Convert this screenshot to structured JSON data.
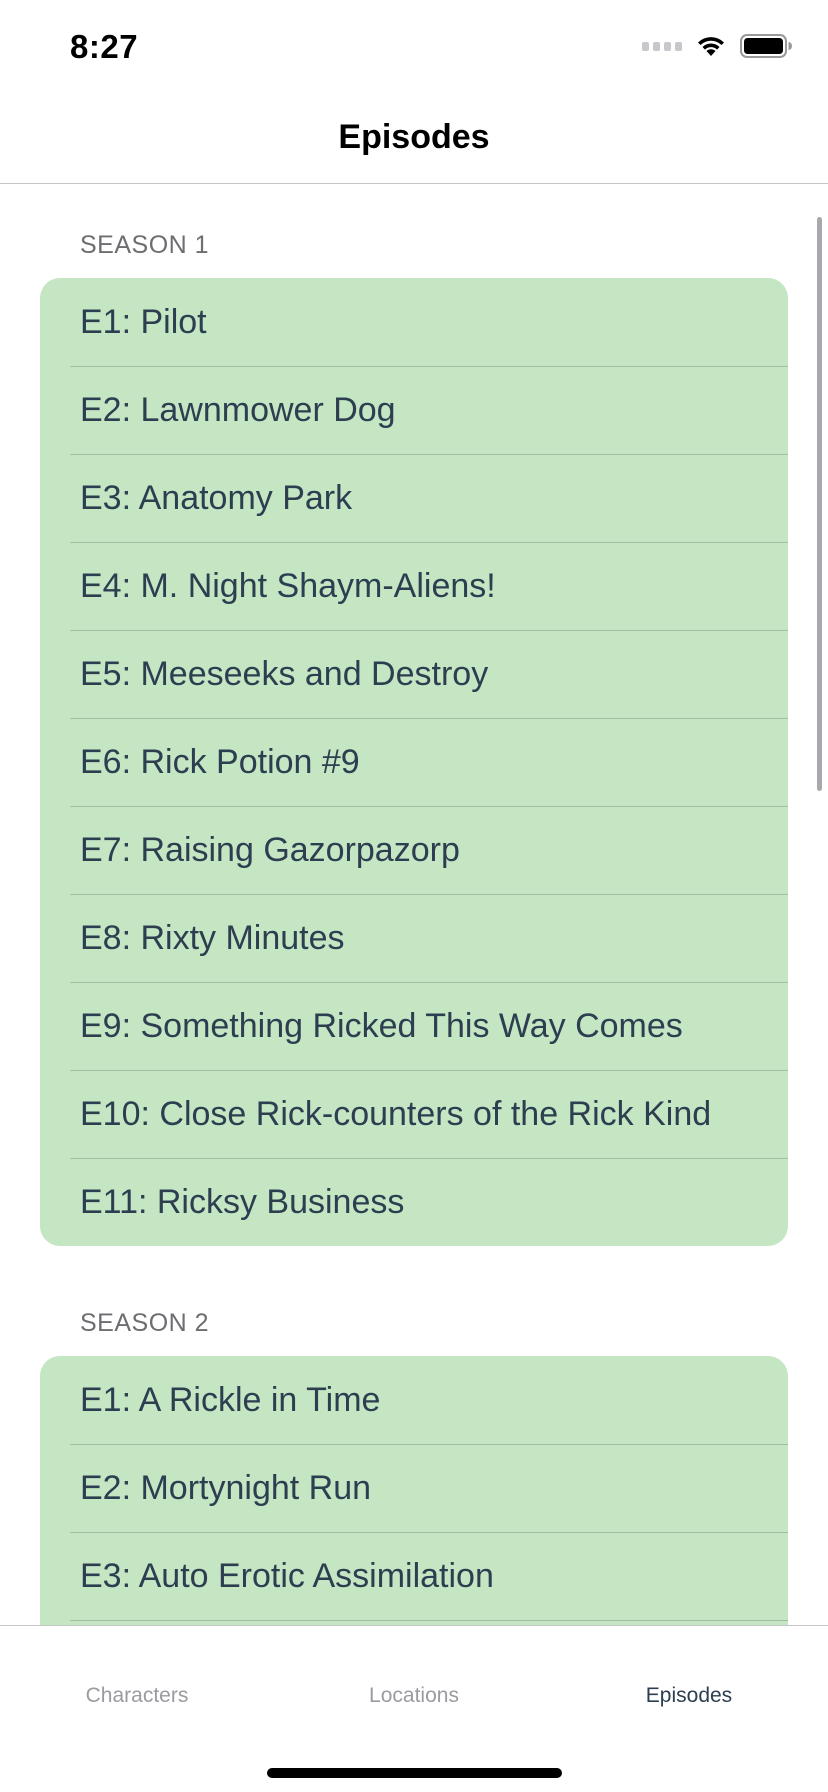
{
  "status_bar": {
    "time": "8:27"
  },
  "nav": {
    "title": "Episodes"
  },
  "sections": [
    {
      "header": "SEASON 1",
      "episodes": [
        "E1: Pilot",
        "E2: Lawnmower Dog",
        "E3: Anatomy Park",
        "E4: M. Night Shaym-Aliens!",
        "E5: Meeseeks and Destroy",
        "E6: Rick Potion #9",
        "E7: Raising Gazorpazorp",
        "E8: Rixty Minutes",
        "E9: Something Ricked This Way Comes",
        "E10: Close Rick-counters of the Rick Kind",
        "E11: Ricksy Business"
      ]
    },
    {
      "header": "SEASON 2",
      "episodes": [
        "E1: A Rickle in Time",
        "E2: Mortynight Run",
        "E3: Auto Erotic Assimilation"
      ]
    }
  ],
  "tab_bar": {
    "tabs": [
      "Characters",
      "Locations",
      "Episodes"
    ],
    "selected": "Episodes"
  },
  "colors": {
    "row_background": "#c4e6c3",
    "row_text": "#2c3e50",
    "tab_selected": "#2c3e50",
    "tab_unselected": "#9a9ba0"
  }
}
